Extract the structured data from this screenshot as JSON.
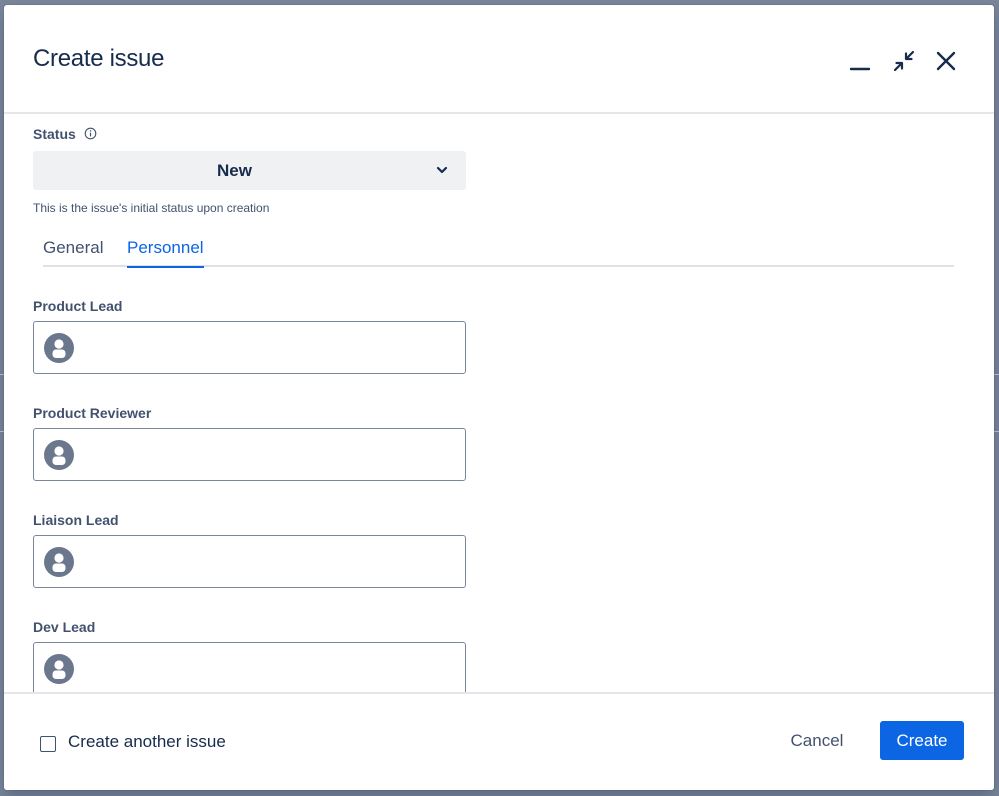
{
  "dialog": {
    "title": "Create issue"
  },
  "status": {
    "label": "Status",
    "value": "New",
    "helper": "This is the issue's initial status upon creation"
  },
  "tabs": [
    {
      "label": "General",
      "active": false
    },
    {
      "label": "Personnel",
      "active": true
    }
  ],
  "fields": [
    {
      "label": "Product Lead",
      "value": ""
    },
    {
      "label": "Product Reviewer",
      "value": ""
    },
    {
      "label": "Liaison Lead",
      "value": ""
    },
    {
      "label": "Dev Lead",
      "value": ""
    }
  ],
  "footer": {
    "checkbox_label": "Create another issue",
    "checkbox_checked": false,
    "cancel_label": "Cancel",
    "create_label": "Create"
  },
  "colors": {
    "primary": "#0c66e4",
    "text": "#172b4d",
    "subtle_text": "#42526e",
    "backdrop": "#7a869a"
  },
  "icons": {
    "minimize": "minimize-icon",
    "collapse": "collapse-arrows-icon",
    "close": "close-icon",
    "info": "info-icon",
    "chevron": "chevron-down-icon",
    "avatar": "user-avatar-icon"
  }
}
